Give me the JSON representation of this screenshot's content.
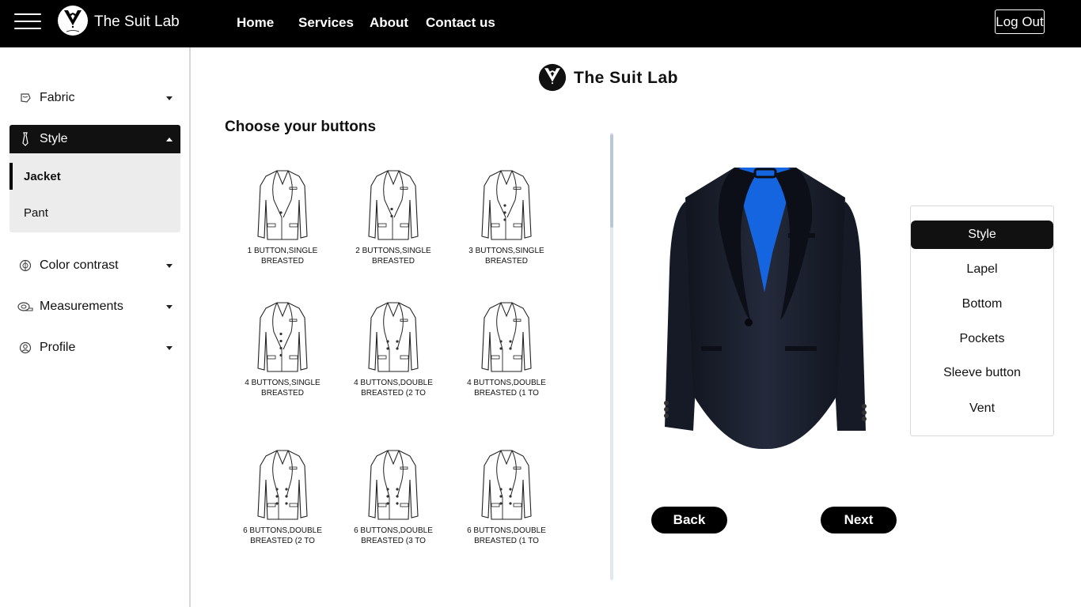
{
  "header": {
    "brand": "The Suit Lab",
    "nav": [
      "Home",
      "Services",
      "About",
      "Contact us"
    ],
    "logout_label": "Log Out"
  },
  "sidebar": {
    "items": [
      {
        "label": "Fabric",
        "icon": "fabric-icon"
      },
      {
        "label": "Style",
        "icon": "tie-icon"
      },
      {
        "label": "Color contrast",
        "icon": "palette-icon"
      },
      {
        "label": "Measurements",
        "icon": "measuring-tape-icon"
      },
      {
        "label": "Profile",
        "icon": "user-circle-icon"
      }
    ],
    "style_submenu": [
      {
        "label": "Jacket"
      },
      {
        "label": "Pant"
      }
    ]
  },
  "main": {
    "brand": "The Suit Lab",
    "section_title": "Choose your buttons",
    "options": [
      {
        "line1": "1 BUTTON,SINGLE",
        "line2": "BREASTED"
      },
      {
        "line1": "2 BUTTONS,SINGLE",
        "line2": "BREASTED"
      },
      {
        "line1": "3 BUTTONS,SINGLE",
        "line2": "BREASTED"
      },
      {
        "line1": "4 BUTTONS,SINGLE",
        "line2": "BREASTED"
      },
      {
        "line1": "4 BUTTONS,DOUBLE",
        "line2": "BREASTED (2 TO"
      },
      {
        "line1": "4 BUTTONS,DOUBLE",
        "line2": "BREASTED (1 TO"
      },
      {
        "line1": "6 BUTTONS,DOUBLE",
        "line2": "BREASTED (2 TO"
      },
      {
        "line1": "6 BUTTONS,DOUBLE",
        "line2": "BREASTED (3 TO"
      },
      {
        "line1": "6 BUTTONS,DOUBLE",
        "line2": "BREASTED (1 TO"
      }
    ]
  },
  "style_panel": {
    "items": [
      "Style",
      "Lapel",
      "Bottom",
      "Pockets",
      "Sleeve button",
      "Vent"
    ]
  },
  "actions": {
    "back_label": "Back",
    "next_label": "Next"
  },
  "colors": {
    "header_bg": "#000000",
    "accent_dark": "#111111",
    "jacket_lining": "#1565e0",
    "jacket_body": "#1a1f2e"
  }
}
